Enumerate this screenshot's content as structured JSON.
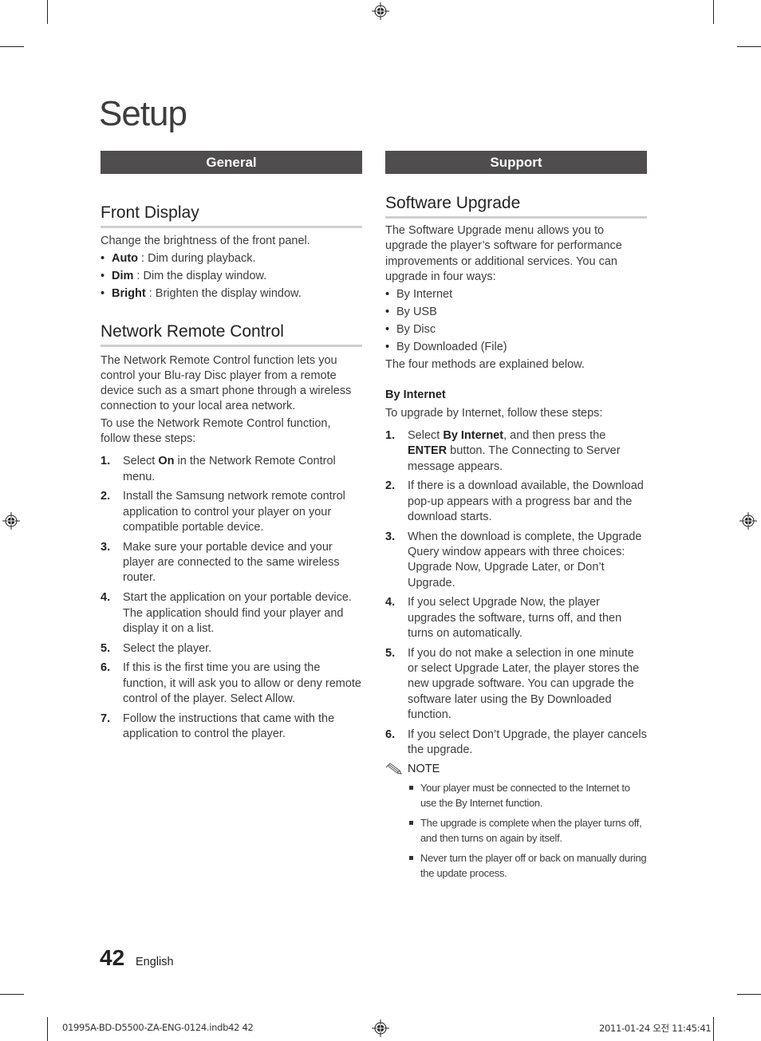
{
  "page": {
    "title": "Setup",
    "tabs": {
      "left": "General",
      "right": "Support"
    },
    "page_number": "42",
    "language": "English"
  },
  "front_display": {
    "heading": "Front Display",
    "intro": "Change the brightness of the front panel.",
    "options": [
      {
        "name": "Auto",
        "desc": " : Dim during playback."
      },
      {
        "name": "Dim",
        "desc": " : Dim the display window."
      },
      {
        "name": "Bright",
        "desc": " : Brighten the display window."
      }
    ]
  },
  "network_remote": {
    "heading": "Network Remote Control",
    "intro1": "The Network Remote Control function lets you control your Blu-ray Disc player from a remote device such as a smart phone through a wireless connection to your local area network.",
    "intro2": "To use the Network Remote Control function, follow these steps:",
    "steps": [
      {
        "num": "1.",
        "pre": "Select ",
        "bold": "On",
        "post": " in the Network Remote Control menu."
      },
      {
        "num": "2.",
        "text": "Install the Samsung network remote control application to control your player on your compatible portable device."
      },
      {
        "num": "3.",
        "text": "Make sure your portable device and your player are connected to the same wireless router."
      },
      {
        "num": "4.",
        "text": "Start the application on your portable device. The application should find your player and display it on a list."
      },
      {
        "num": "5.",
        "text": "Select the player."
      },
      {
        "num": "6.",
        "text": "If this is the first time you are using the function, it will ask you to allow or deny remote control of the player. Select Allow."
      },
      {
        "num": "7.",
        "text": "Follow the instructions that came with the application to control the player."
      }
    ]
  },
  "software_upgrade": {
    "heading": "Software Upgrade",
    "intro": "The Software Upgrade menu allows you to upgrade the player’s software for performance improvements or additional services. You can upgrade in four ways:",
    "methods": [
      "By Internet",
      "By USB",
      "By Disc",
      "By Downloaded (File)"
    ],
    "outro": "The four methods are explained below.",
    "by_internet": {
      "subheading": "By Internet",
      "intro": "To upgrade by Internet, follow these steps:",
      "step1": {
        "num": "1.",
        "a": "Select ",
        "b1": "By Internet",
        "c": ", and then press the ",
        "b2": "ENTER",
        "d": " button. The Connecting to Server message appears."
      },
      "steps": [
        {
          "num": "2.",
          "text": "If there is a download available, the Download pop-up appears with a progress bar and the download starts."
        },
        {
          "num": "3.",
          "text": "When the download is complete, the Upgrade Query window appears with three choices: Upgrade Now, Upgrade Later, or Don’t Upgrade."
        },
        {
          "num": "4.",
          "text": "If you select Upgrade Now, the player upgrades the software, turns off, and then turns on automatically."
        },
        {
          "num": "5.",
          "text": "If you do not make a selection in one minute or select Upgrade Later, the player stores the new upgrade software. You can upgrade the software later using the By Downloaded function."
        },
        {
          "num": "6.",
          "text": "If you select Don’t Upgrade, the player cancels the upgrade."
        }
      ]
    },
    "note": {
      "label": "NOTE",
      "items": [
        "Your player must be connected to the Internet to use the By Internet function.",
        "The upgrade is complete when the player turns off, and then turns on again by itself.",
        "Never turn the player off or back on manually during the update process."
      ]
    }
  },
  "print_footer": {
    "file": "01995A-BD-D5500-ZA-ENG-0124.indb42   42",
    "date": "2011-01-24   오전 11:45:41"
  }
}
